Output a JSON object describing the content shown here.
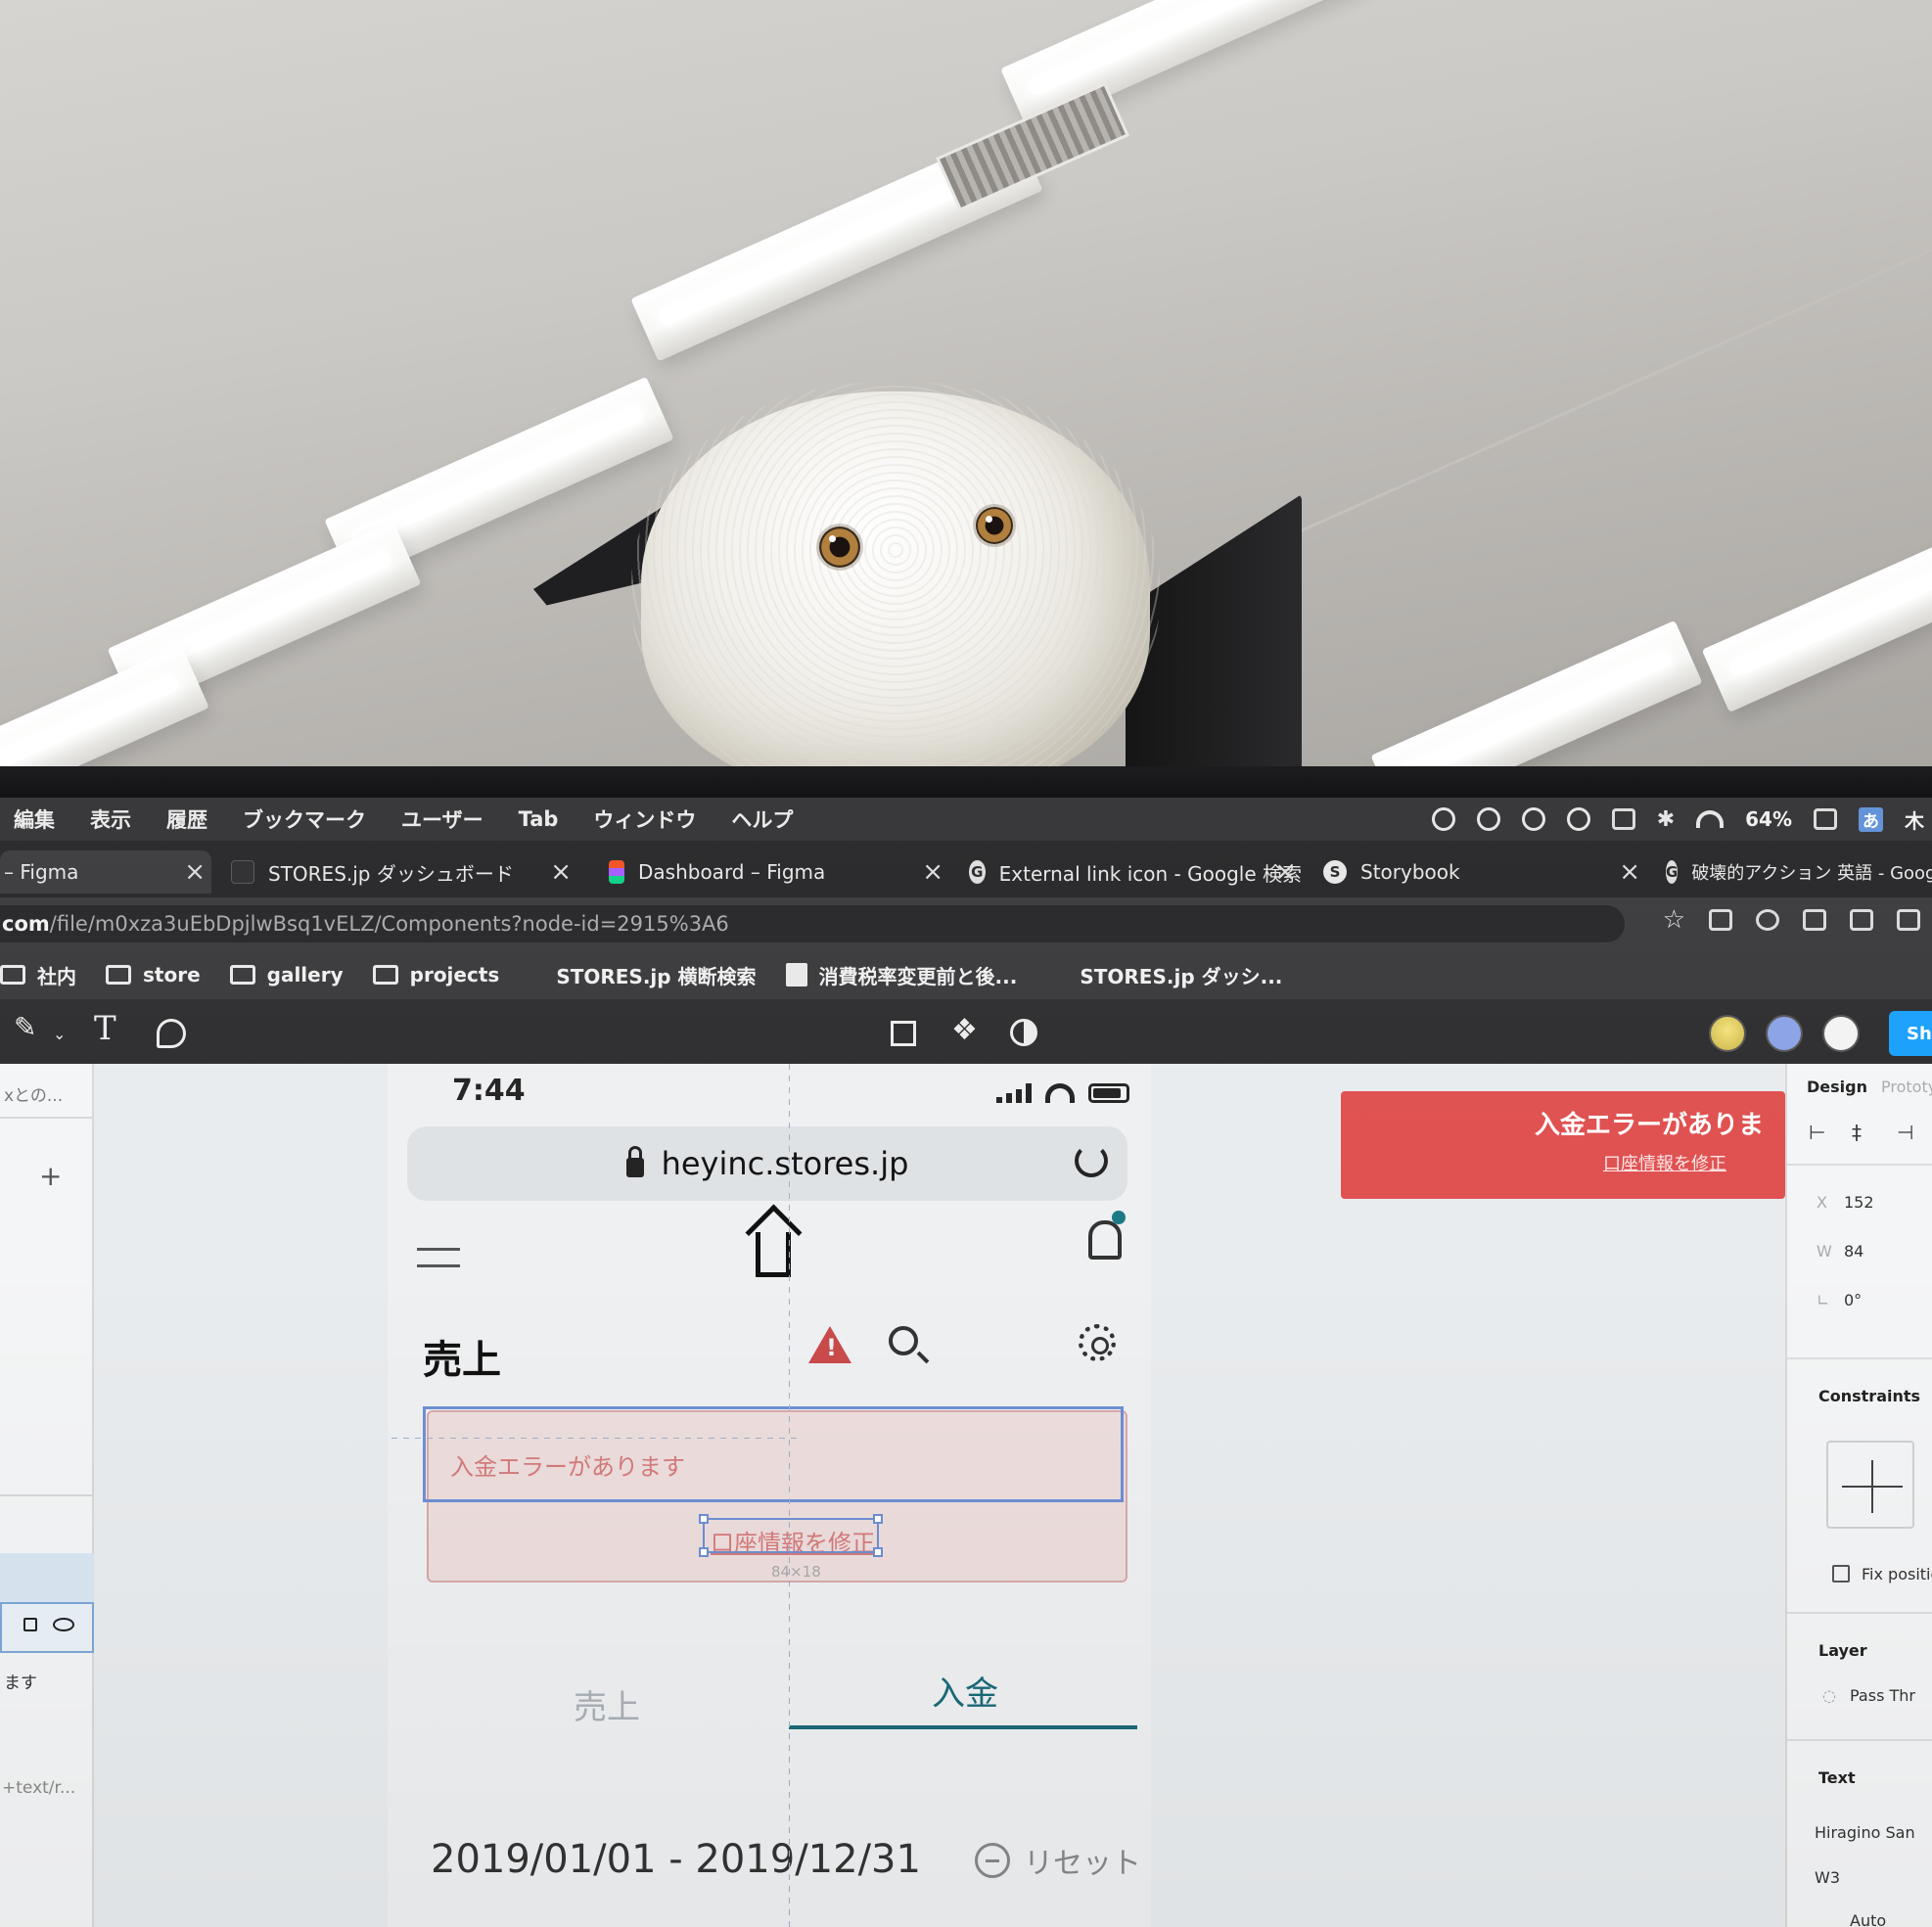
{
  "menubar": {
    "items": [
      "編集",
      "表示",
      "履歴",
      "ブックマーク",
      "ユーザー",
      "Tab",
      "ウィンドウ",
      "ヘルプ"
    ],
    "battery": "64%",
    "ime": "あ",
    "day": "木"
  },
  "tabs": [
    {
      "title": "– Figma"
    },
    {
      "title": "STORES.jp ダッシュボード"
    },
    {
      "title": "Dashboard – Figma"
    },
    {
      "title": "External link icon - Google 検索"
    },
    {
      "title": "Storybook"
    },
    {
      "title": "破壊的アクション 英語 - Google"
    }
  ],
  "tab_close": "×",
  "address": {
    "host": "com",
    "path": "/file/m0xza3uEbDpjlwBsq1vELZ/Components?node-id=2915%3A6"
  },
  "bookmarks": [
    "社内",
    "store",
    "gallery",
    "projects",
    "STORES.jp 横断検索",
    "消費税率変更前と後...",
    "STORES.jp ダッシ..."
  ],
  "figma": {
    "share_label": "Sha",
    "left_panel": {
      "top_text": "xとの...",
      "row_text": "ます",
      "bottom_text": "+text/r..."
    },
    "right_panel": {
      "tab_design": "Design",
      "tab_prototype": "Prototy",
      "x_label": "X",
      "x_value": "152",
      "w_label": "W",
      "w_value": "84",
      "r_value": "0°",
      "constraints": "Constraints",
      "fix_position": "Fix positio",
      "layer": "Layer",
      "pass_through": "Pass Thr",
      "text": "Text",
      "font": "Hiragino San",
      "weight": "W3",
      "auto": "Auto"
    }
  },
  "phone": {
    "time": "7:44",
    "url": "heyinc.stores.jp",
    "section_title": "売上",
    "error_message": "入金エラーがあります",
    "error_link": "口座情報を修正",
    "selection_size": "84×18",
    "tab_sales": "売上",
    "tab_deposit": "入金",
    "date_range": "2019/01/01 - 2019/12/31",
    "reset": "リセット"
  },
  "banner": {
    "title": "入金エラーがありま",
    "link": "口座情報を修正"
  }
}
